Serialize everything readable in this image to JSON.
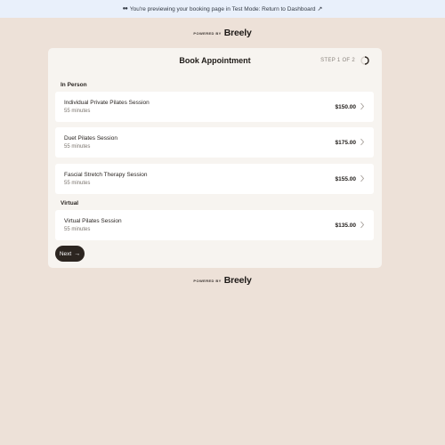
{
  "banner": {
    "eyes_icon": "eyes-icon",
    "message": "You're previewing your booking page in Test Mode: Return to Dashboard",
    "external_icon": "↗"
  },
  "powered_by": {
    "label": "POWERED BY",
    "brand": "Breely"
  },
  "card": {
    "title": "Book Appointment",
    "step": "STEP 1 OF 2",
    "progress_fraction": 0.5
  },
  "sections": [
    {
      "label": "In Person",
      "services": [
        {
          "name": "Individual Private Pilates Session",
          "duration": "55 minutes",
          "price": "$150.00"
        },
        {
          "name": "Duet Pilates Session",
          "duration": "55 minutes",
          "price": "$175.00"
        },
        {
          "name": "Fascial Stretch Therapy Session",
          "duration": "55 minutes",
          "price": "$155.00"
        }
      ]
    },
    {
      "label": "Virtual",
      "services": [
        {
          "name": "Virtual Pilates Session",
          "duration": "55 minutes",
          "price": "$135.00"
        }
      ]
    }
  ],
  "actions": {
    "next_label": "Next",
    "next_icon": "→"
  },
  "colors": {
    "background": "#ede1d8",
    "card": "#f7f4f0",
    "banner": "#e9f0fb",
    "button": "#2c2520"
  }
}
